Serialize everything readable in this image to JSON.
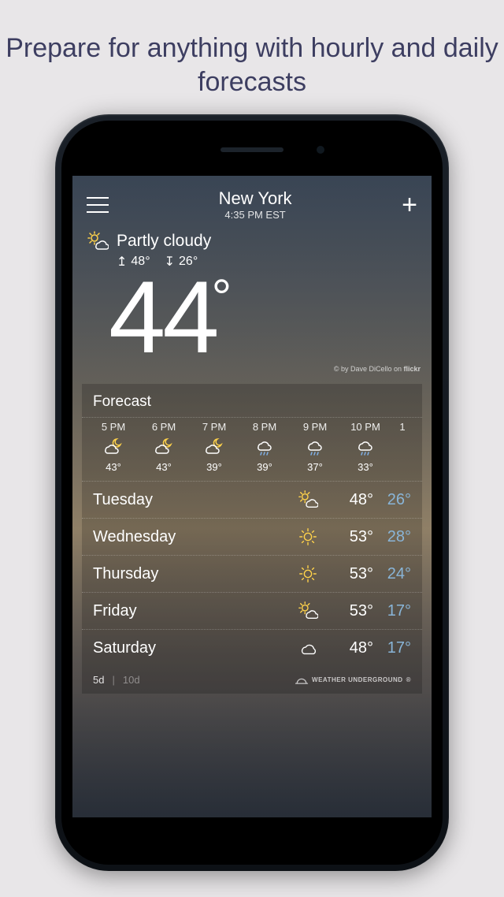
{
  "headline": "Prepare for anything with hourly and daily forecasts",
  "location": {
    "name": "New York",
    "time": "4:35 PM EST"
  },
  "current": {
    "condition": "Partly cloudy",
    "high": "48°",
    "low": "26°",
    "temp": "44"
  },
  "attribution": {
    "text": "© by Dave DiCello on ",
    "brand": "flickr"
  },
  "panel_title": "Forecast",
  "hourly": [
    {
      "time": "5 PM",
      "icon": "night-cloud",
      "temp": "43°"
    },
    {
      "time": "6 PM",
      "icon": "night-cloud",
      "temp": "43°"
    },
    {
      "time": "7 PM",
      "icon": "night-cloud",
      "temp": "39°"
    },
    {
      "time": "8 PM",
      "icon": "rain",
      "temp": "39°"
    },
    {
      "time": "9 PM",
      "icon": "rain",
      "temp": "37°"
    },
    {
      "time": "10 PM",
      "icon": "rain",
      "temp": "33°"
    },
    {
      "time": "1",
      "icon": "",
      "temp": ""
    }
  ],
  "daily": [
    {
      "day": "Tuesday",
      "icon": "partly-cloudy",
      "high": "48°",
      "low": "26°"
    },
    {
      "day": "Wednesday",
      "icon": "sunny",
      "high": "53°",
      "low": "28°"
    },
    {
      "day": "Thursday",
      "icon": "sunny",
      "high": "53°",
      "low": "24°"
    },
    {
      "day": "Friday",
      "icon": "partly-cloudy",
      "high": "53°",
      "low": "17°"
    },
    {
      "day": "Saturday",
      "icon": "cloudy",
      "high": "48°",
      "low": "17°"
    }
  ],
  "range": {
    "five": "5d",
    "ten": "10d"
  },
  "footer_brand": "WEATHER UNDERGROUND"
}
